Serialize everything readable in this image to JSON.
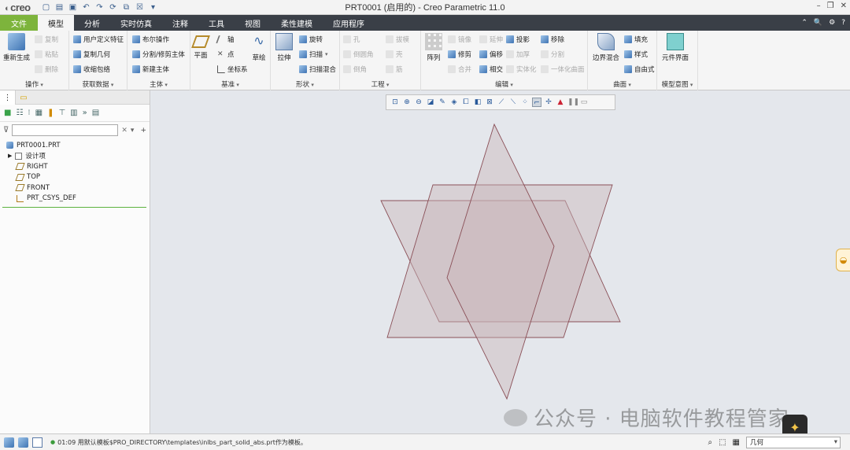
{
  "app": {
    "logo": "creo",
    "window_title": "PRT0001 (启用的) - Creo Parametric 11.0"
  },
  "tabs": [
    "文件",
    "模型",
    "分析",
    "实时仿真",
    "注释",
    "工具",
    "视图",
    "柔性建模",
    "应用程序"
  ],
  "ribbon": {
    "operations": {
      "title": "操作",
      "regenerate": "重新生成",
      "copy": "复制",
      "paste": "粘贴",
      "delete": "删除"
    },
    "get_data": {
      "title": "获取数据",
      "udf": "用户定义特征",
      "copy_geom": "复制几何",
      "shrinkwrap": "收缩包络"
    },
    "body": {
      "title": "主体",
      "boolean": "布尔操作",
      "split": "分割/修剪主体",
      "new_body": "新建主体"
    },
    "datum": {
      "title": "基准",
      "plane": "平面",
      "axis": "轴",
      "point": "点",
      "csys": "坐标系",
      "sketch": "草绘"
    },
    "shapes": {
      "title": "形状",
      "extrude": "拉伸",
      "revolve": "旋转",
      "sweep": "扫描",
      "swept_blend": "扫描混合"
    },
    "engineering": {
      "title": "工程",
      "hole": "孔",
      "draft": "拔模",
      "round": "倒圆角",
      "shell": "壳",
      "chamfer": "倒角",
      "rib": "筋"
    },
    "editing": {
      "title": "编辑",
      "pattern": "阵列",
      "mirror": "镜像",
      "extend": "延伸",
      "project": "投影",
      "trim": "修剪",
      "offset": "偏移",
      "thicken": "加厚",
      "merge": "合并",
      "intersect": "相交",
      "solidify": "实体化",
      "remove": "移除",
      "split": "分割",
      "unify": "一体化曲面"
    },
    "surfaces": {
      "title": "曲面",
      "boundary_blend": "边界混合",
      "fill": "填充",
      "style": "样式",
      "freestyle": "自由式"
    },
    "model_intent": {
      "title": "模型意图",
      "component_interface": "元件界面"
    }
  },
  "tree": {
    "filter_placeholder": "",
    "items": [
      "PRT0001.PRT",
      "设计项",
      "RIGHT",
      "TOP",
      "FRONT",
      "PRT_CSYS_DEF"
    ]
  },
  "status": {
    "message": "01:09 用默认模板$PRO_DIRECTORY\\templates\\inlbs_part_solid_abs.prt作为模板。",
    "selection_filter": "几何"
  },
  "watermark": "公众号 · 电脑软件教程管家",
  "colors": {
    "file_tab": "#7db43c",
    "tab_bar": "#3a3f47",
    "plane_fill": "#c9b6bb",
    "plane_edge": "#8a4f57"
  }
}
